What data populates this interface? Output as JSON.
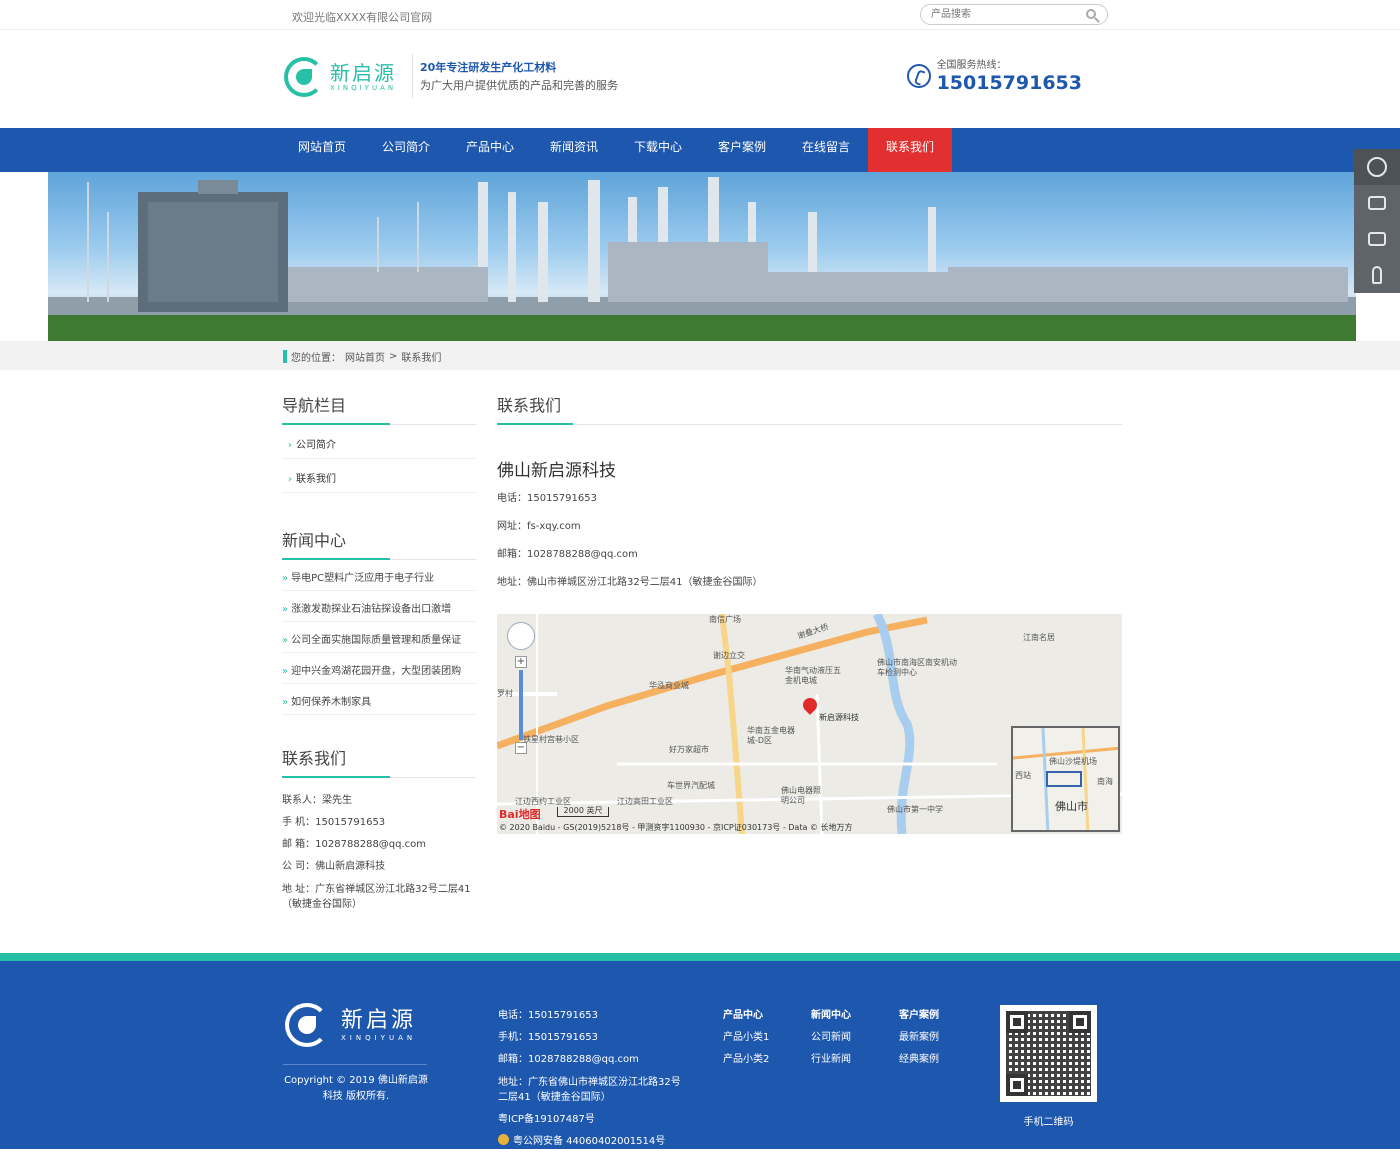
{
  "topbar": {
    "welcome": "欢迎光临XXXX有限公司官网",
    "search_placeholder": "产品搜索"
  },
  "header": {
    "logo_cn": "新启源",
    "logo_en": "XINQIYUAN",
    "slogan_1": "20年专注研发生产化工材料",
    "slogan_2": "为广大用户提供优质的产品和完善的服务",
    "hotline_label": "全国服务热线：",
    "hotline_number": "15015791653"
  },
  "nav": {
    "items": [
      {
        "label": "网站首页"
      },
      {
        "label": "公司简介"
      },
      {
        "label": "产品中心"
      },
      {
        "label": "新闻资讯"
      },
      {
        "label": "下载中心"
      },
      {
        "label": "客户案例"
      },
      {
        "label": "在线留言"
      },
      {
        "label": "联系我们"
      }
    ]
  },
  "breadcrumb": {
    "prefix": "您的位置：",
    "home": "网站首页",
    "sep": ">",
    "current": "联系我们"
  },
  "sidebar": {
    "nav_title": "导航栏目",
    "nav_items": [
      {
        "label": "公司简介"
      },
      {
        "label": "联系我们"
      }
    ],
    "news_title": "新闻中心",
    "news_items": [
      {
        "label": "导电PC塑料广泛应用于电子行业"
      },
      {
        "label": "涨激发勘探业石油钻探设备出口激增"
      },
      {
        "label": "公司全面实施国际质量管理和质量保证"
      },
      {
        "label": "迎中兴金鸡湖花园开盘，大型团装团购"
      },
      {
        "label": "如何保养木制家具"
      }
    ],
    "contact_title": "联系我们",
    "contact": {
      "person": "联系人：梁先生",
      "mobile": "手 机：15015791653",
      "email": "邮 箱：1028788288@qq.com",
      "company": "公 司：佛山新启源科技",
      "address": "地 址：广东省禅城区汾江北路32号二层41（敏捷金谷国际）"
    }
  },
  "content": {
    "title": "联系我们",
    "company": "佛山新启源科技",
    "phone": "电话：15015791653",
    "website": "网址：fs-xqy.com",
    "email": "邮箱：1028788288@qq.com",
    "address": "地址：佛山市禅城区汾江北路32号二层41（敏捷金谷国际）"
  },
  "map": {
    "labels": [
      "南信广场",
      "谢叠大桥",
      "谢边立交",
      "华南气动液压五金机电城",
      "佛山市南海区南安机动车检测中心",
      "江南名居",
      "华泓商业城",
      "罗村",
      "好万家超市",
      "华南五金电器城-D区",
      "铁星村宫巷小区",
      "车世界汽配城",
      "佛山电器照明公司",
      "佛山市第一中学",
      "江边西约工业区",
      "江边高田工业区"
    ],
    "pin_label": "新启源科技",
    "scale": "2000 英尺",
    "logo": "Bai地图",
    "copyright": "© 2020 Baidu - GS(2019)5218号 - 甲测资字1100930 - 京ICP证030173号 - Data © 长地万方",
    "minimap_city": "佛山市",
    "minimap_labels": [
      "佛山沙堤机场",
      "西站",
      "南海"
    ],
    "zoom_in": "+",
    "zoom_out": "−"
  },
  "footer": {
    "logo_cn": "新启源",
    "logo_en": "XINQIYUAN",
    "copyright": "Copyright © 2019 佛山新启源科技 版权所有.",
    "phone": "电话：15015791653",
    "mobile": "手机：15015791653",
    "email": "邮箱：1028788288@qq.com",
    "address": "地址：广东省佛山市禅城区汾江北路32号二层41（敏捷金谷国际）",
    "icp": "粤ICP备19107487号",
    "police": "粤公网安备 44060402001514号",
    "columns": [
      {
        "head": "产品中心",
        "items": [
          "产品小类1",
          "产品小类2"
        ]
      },
      {
        "head": "新闻中心",
        "items": [
          "公司新闻",
          "行业新闻"
        ]
      },
      {
        "head": "客户案例",
        "items": [
          "最新案例",
          "经典案例"
        ]
      }
    ],
    "qr_label": "手机二维码"
  },
  "colors": {
    "primary": "#1e58ae",
    "accent": "#27bfa6",
    "active_nav": "#e22f2f"
  }
}
